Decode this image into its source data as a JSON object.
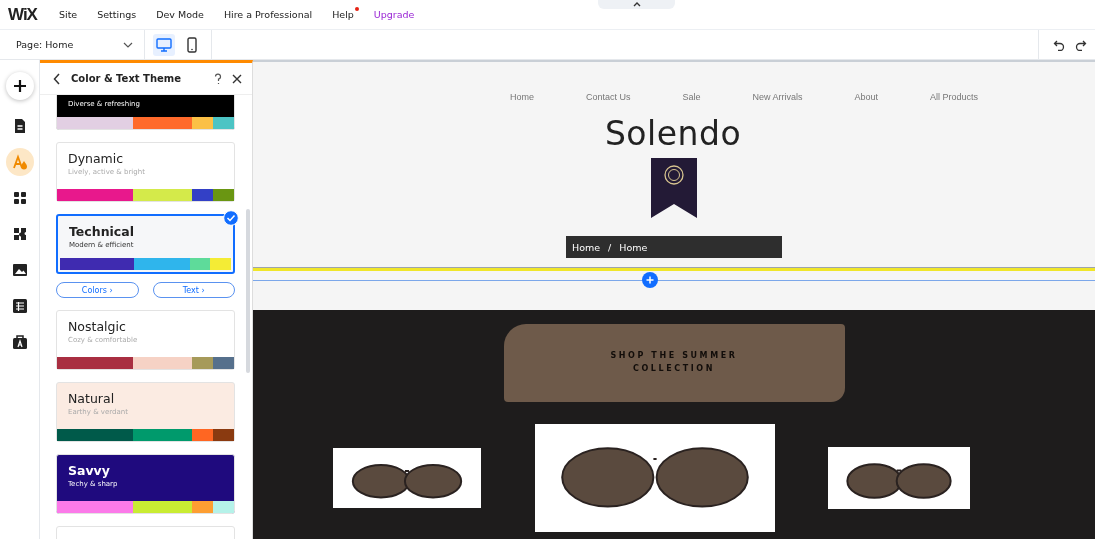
{
  "topbar": {
    "logo": "WiX",
    "menu": [
      {
        "label": "Site",
        "kind": "plain"
      },
      {
        "label": "Settings",
        "kind": "plain"
      },
      {
        "label": "Dev Mode",
        "kind": "plain"
      },
      {
        "label": "Hire a Professional",
        "kind": "plain"
      },
      {
        "label": "Help",
        "kind": "notify"
      },
      {
        "label": "Upgrade",
        "kind": "upgrade"
      }
    ]
  },
  "toolbar": {
    "page_select": "Page: Home",
    "views": [
      {
        "kind": "desktop",
        "selected": true
      },
      {
        "kind": "mobile",
        "selected": false
      }
    ]
  },
  "rail": [
    {
      "kind": "add",
      "selected": false
    },
    {
      "kind": "pages",
      "selected": false
    },
    {
      "kind": "theme",
      "selected": true
    },
    {
      "kind": "apps",
      "selected": false
    },
    {
      "kind": "puzzle",
      "selected": false
    },
    {
      "kind": "media",
      "selected": false
    },
    {
      "kind": "table",
      "selected": false
    },
    {
      "kind": "business",
      "selected": false
    }
  ],
  "panel": {
    "title": "Color & Text Theme",
    "themes": [
      {
        "subtitle": "Diverse & refreshing",
        "color": "#000000",
        "dark": true,
        "selected": false,
        "palette": [
          {
            "color": "#e2cfe3"
          },
          {
            "color": "#ff6a2b"
          },
          {
            "color": "#fbc046"
          },
          {
            "color": "#4cc4c4"
          }
        ]
      },
      {
        "name": "Dynamic",
        "subtitle": "Lively, active & bright",
        "color": "#ffffff",
        "dark": false,
        "selected": false,
        "palette": [
          {
            "color": "#e8188c"
          },
          {
            "color": "#d4ea4a"
          },
          {
            "color": "#3340c6"
          },
          {
            "color": "#6a9612"
          }
        ]
      },
      {
        "name": "Technical",
        "subtitle": "Modern & efficient",
        "color": "#f6f7f9",
        "dark": false,
        "selected": true,
        "palette": [
          {
            "color": "#3f2bb0"
          },
          {
            "color": "#2fb5ec"
          },
          {
            "color": "#5edb9a"
          },
          {
            "color": "#f4ec35"
          }
        ]
      },
      {
        "name": "Nostalgic",
        "subtitle": "Cozy & comfortable",
        "color": "#ffffff",
        "dark": false,
        "selected": false,
        "palette": [
          {
            "color": "#a92f41"
          },
          {
            "color": "#f6d2c5"
          },
          {
            "color": "#a69a5a"
          },
          {
            "color": "#56708c"
          }
        ]
      },
      {
        "name": "Natural",
        "subtitle": "Earthy & verdant",
        "color": "#fbebe2",
        "dark": false,
        "selected": false,
        "palette": [
          {
            "color": "#005a4a"
          },
          {
            "color": "#009a6c"
          },
          {
            "color": "#ff6622"
          },
          {
            "color": "#8a3a10"
          }
        ]
      },
      {
        "name": "Savvy",
        "subtitle": "Techy & sharp",
        "color": "#1f0a7e",
        "dark": true,
        "selected": false,
        "palette": [
          {
            "color": "#fb7ae9"
          },
          {
            "color": "#c9ec33"
          },
          {
            "color": "#fd9e32"
          },
          {
            "color": "#b5f2e9"
          }
        ]
      },
      {
        "color": "#ffffff",
        "selected": false
      }
    ],
    "actions": [
      "Colors ›",
      "Text ›"
    ]
  },
  "site": {
    "nav": [
      "Home",
      "Contact Us",
      "Sale",
      "New Arrivals",
      "About",
      "All Products"
    ],
    "brand": "Solendo",
    "breadcrumb": [
      "Home",
      "/",
      "Home"
    ],
    "cta": "SHOP THE SUMMER\nCOLLECTION"
  }
}
